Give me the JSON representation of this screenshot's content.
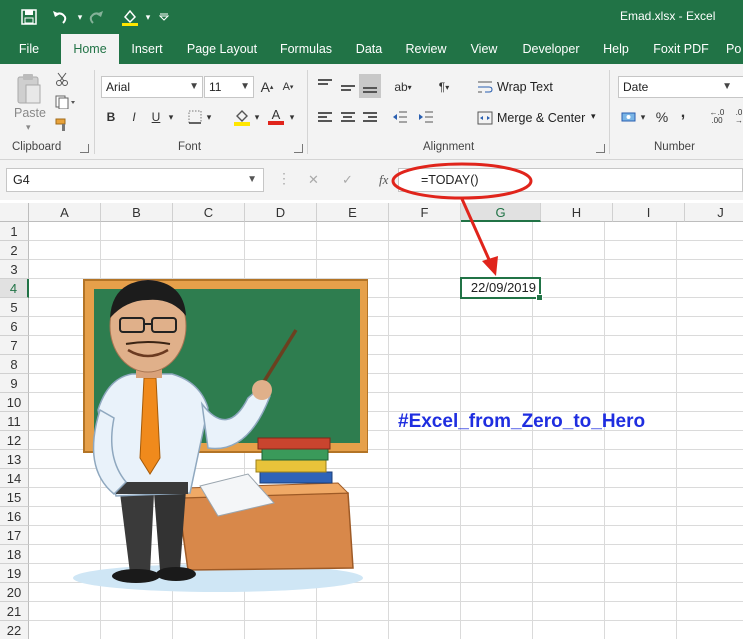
{
  "window": {
    "title": "Emad.xlsx  -  Excel"
  },
  "tabs": [
    "File",
    "Home",
    "Insert",
    "Page Layout",
    "Formulas",
    "Data",
    "Review",
    "View",
    "Developer",
    "Help",
    "Foxit PDF",
    "Po"
  ],
  "active_tab": "Home",
  "ribbon": {
    "clipboard": {
      "label": "Clipboard",
      "paste": "Paste"
    },
    "font": {
      "label": "Font",
      "name": "Arial",
      "size": "11",
      "bold": "B",
      "italic": "I",
      "underline": "U",
      "grow": "A",
      "shrink": "A",
      "color": "A"
    },
    "alignment": {
      "label": "Alignment",
      "wrap_text": "Wrap Text",
      "merge_center": "Merge & Center"
    },
    "number": {
      "label": "Number",
      "format": "Date",
      "percent": "%",
      "comma": ","
    }
  },
  "formula_bar": {
    "name_box": "G4",
    "formula": "=TODAY()"
  },
  "columns": [
    "A",
    "B",
    "C",
    "D",
    "E",
    "F",
    "G",
    "H",
    "I",
    "J"
  ],
  "rows": [
    "1",
    "2",
    "3",
    "4",
    "5",
    "6",
    "7",
    "8",
    "9",
    "10",
    "11",
    "12",
    "13",
    "14",
    "15",
    "16",
    "17",
    "18",
    "19",
    "20",
    "21",
    "22"
  ],
  "active_cell": {
    "ref": "G4",
    "value": "22/09/2019"
  },
  "sheet_text": {
    "hashtag": "#Excel_from_Zero_to_Hero"
  },
  "colors": {
    "excel_green": "#217346",
    "highlight_red": "#e0241b",
    "hashtag_blue": "#1f2ee0",
    "chalkboard": "#2e7d4f"
  }
}
